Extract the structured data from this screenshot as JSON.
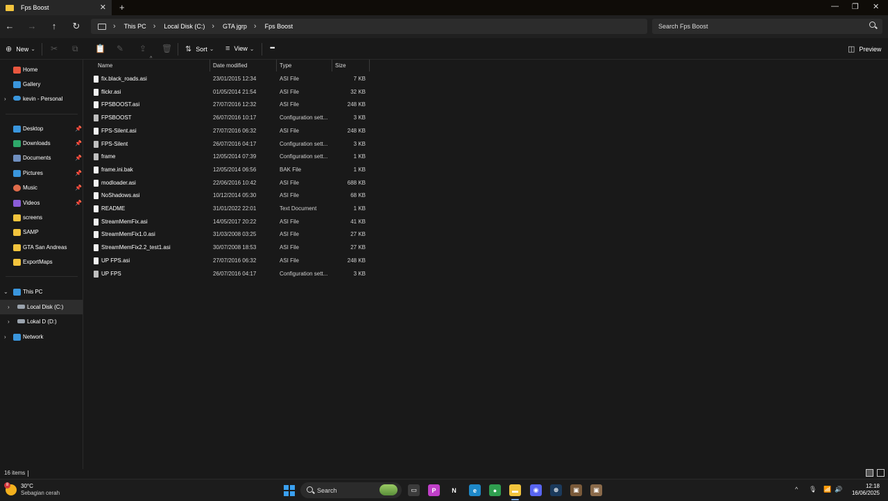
{
  "window": {
    "tab_title": "Fps Boost",
    "tab_close": "✕",
    "new_tab": "+",
    "minimize": "—",
    "restore": "❐",
    "close": "✕"
  },
  "nav": {
    "back": "←",
    "forward": "→",
    "up": "↑",
    "refresh": "↻",
    "breadcrumbs": [
      "This PC",
      "Local Disk (C:)",
      "GTA jgrp",
      "Fps Boost"
    ],
    "separator": "›",
    "search_placeholder": "Search Fps Boost"
  },
  "toolbar": {
    "new_label": "New",
    "new_icon": "⊕",
    "sort_label": "Sort",
    "sort_icon": "⇅",
    "view_label": "View",
    "view_icon": "≡",
    "more": "•••",
    "preview_label": "Preview",
    "preview_icon": "◫",
    "caret": "⌄"
  },
  "sidebar": {
    "top": [
      {
        "label": "Home",
        "icon": "home-icon",
        "color": "#e9573f"
      },
      {
        "label": "Gallery",
        "icon": "gallery-icon",
        "color": "#3a96dd"
      },
      {
        "label": "kevin - Personal",
        "icon": "onedrive-icon",
        "color": "#3a96dd"
      }
    ],
    "pinned": [
      {
        "label": "Desktop",
        "color": "#3a96dd"
      },
      {
        "label": "Downloads",
        "color": "#2ea86a"
      },
      {
        "label": "Documents",
        "color": "#6f8fbf"
      },
      {
        "label": "Pictures",
        "color": "#3a96dd"
      },
      {
        "label": "Music",
        "color": "#e06c4b"
      },
      {
        "label": "Videos",
        "color": "#8a5cd8"
      }
    ],
    "folders": [
      {
        "label": "screens"
      },
      {
        "label": "SAMP"
      },
      {
        "label": "GTA San Andreas"
      },
      {
        "label": "ExportMaps"
      }
    ],
    "tree": [
      {
        "label": "This PC",
        "chevron": "⌄"
      },
      {
        "label": "Local Disk (C:)",
        "chevron": "›"
      },
      {
        "label": "Lokal D (D:)",
        "chevron": "›"
      },
      {
        "label": "Network",
        "chevron": "›"
      }
    ],
    "pin_icon": "📌",
    "expand_chevron": "›",
    "folder_color": "#f2c43d"
  },
  "columns": {
    "name": "Name",
    "date": "Date modified",
    "type": "Type",
    "size": "Size",
    "sort_caret": "^"
  },
  "files": [
    {
      "name": "fix.black_roads.asi",
      "date": "23/01/2015 12:34",
      "type": "ASI File",
      "size": "7 KB",
      "kind": "file"
    },
    {
      "name": "flickr.asi",
      "date": "01/05/2014 21:54",
      "type": "ASI File",
      "size": "32 KB",
      "kind": "file"
    },
    {
      "name": "FPSBOOST.asi",
      "date": "27/07/2016 12:32",
      "type": "ASI File",
      "size": "248 KB",
      "kind": "file"
    },
    {
      "name": "FPSBOOST",
      "date": "26/07/2016 10:17",
      "type": "Configuration sett...",
      "size": "3 KB",
      "kind": "cfg"
    },
    {
      "name": "FPS-Silent.asi",
      "date": "27/07/2016 06:32",
      "type": "ASI File",
      "size": "248 KB",
      "kind": "file"
    },
    {
      "name": "FPS-Silent",
      "date": "26/07/2016 04:17",
      "type": "Configuration sett...",
      "size": "3 KB",
      "kind": "cfg"
    },
    {
      "name": "frame",
      "date": "12/05/2014 07:39",
      "type": "Configuration sett...",
      "size": "1 KB",
      "kind": "cfg"
    },
    {
      "name": "frame.ini.bak",
      "date": "12/05/2014 06:56",
      "type": "BAK File",
      "size": "1 KB",
      "kind": "file"
    },
    {
      "name": "modloader.asi",
      "date": "22/06/2016 10:42",
      "type": "ASI File",
      "size": "688 KB",
      "kind": "file"
    },
    {
      "name": "NoShadows.asi",
      "date": "10/12/2014 05:30",
      "type": "ASI File",
      "size": "68 KB",
      "kind": "file"
    },
    {
      "name": "README",
      "date": "31/01/2022 22:01",
      "type": "Text Document",
      "size": "1 KB",
      "kind": "file"
    },
    {
      "name": "StreamMemFix.asi",
      "date": "14/05/2017 20:22",
      "type": "ASI File",
      "size": "41 KB",
      "kind": "file"
    },
    {
      "name": "StreamMemFix1.0.asi",
      "date": "31/03/2008 03:25",
      "type": "ASI File",
      "size": "27 KB",
      "kind": "file"
    },
    {
      "name": "StreamMemFix2.2_test1.asi",
      "date": "30/07/2008 18:53",
      "type": "ASI File",
      "size": "27 KB",
      "kind": "file"
    },
    {
      "name": "UP FPS.asi",
      "date": "27/07/2016 06:32",
      "type": "ASI File",
      "size": "248 KB",
      "kind": "file"
    },
    {
      "name": "UP FPS",
      "date": "26/07/2016 04:17",
      "type": "Configuration sett...",
      "size": "3 KB",
      "kind": "cfg"
    }
  ],
  "status": {
    "items": "16 items"
  },
  "taskbar": {
    "weather_temp": "30°C",
    "weather_desc": "Sebagian cerah",
    "weather_badge": "8",
    "search_label": "Search",
    "apps": [
      {
        "name": "task-view-icon",
        "glyph": "▭",
        "color": "#3b3b3b"
      },
      {
        "name": "picsart-icon",
        "glyph": "P",
        "color": "#c03fc8"
      },
      {
        "name": "netflix-icon",
        "glyph": "N",
        "color": "#1c1c1c"
      },
      {
        "name": "edge-icon",
        "glyph": "e",
        "color": "#1e88c8"
      },
      {
        "name": "chrome-icon",
        "glyph": "●",
        "color": "#2f9e4f"
      },
      {
        "name": "file-explorer-icon",
        "glyph": "▬",
        "color": "#f2c43d"
      },
      {
        "name": "discord-icon",
        "glyph": "◉",
        "color": "#5865f2"
      },
      {
        "name": "steam-icon",
        "glyph": "⊛",
        "color": "#1b3a5c"
      },
      {
        "name": "game-icon-1",
        "glyph": "▣",
        "color": "#7a5a3a"
      },
      {
        "name": "game-icon-2",
        "glyph": "▣",
        "color": "#8a6a4a"
      }
    ],
    "tray_chevron": "^",
    "mic": "🎙",
    "wifi": "📶",
    "volume": "🔊",
    "time": "12:18",
    "date": "16/06/2025"
  }
}
